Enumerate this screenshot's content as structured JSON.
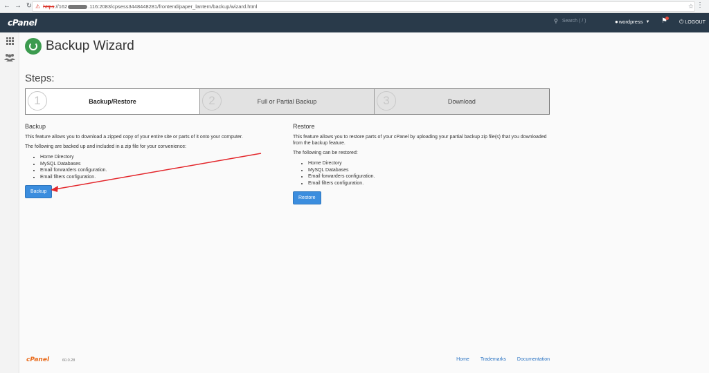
{
  "browser": {
    "url_scheme": "https",
    "url_host_start": "://162",
    "url_rest": ".116:2083/cpsess3448448281/frontend/paper_lantern/backup/wizard.html"
  },
  "header": {
    "logo": "cPanel",
    "search_placeholder": "Search ( / )",
    "username": "wordpress",
    "logout_label": "LOGOUT"
  },
  "page": {
    "title": "Backup Wizard",
    "steps_label": "Steps:"
  },
  "steps": [
    {
      "number": "1",
      "label": "Backup/Restore",
      "active": true
    },
    {
      "number": "2",
      "label": "Full or Partial Backup",
      "active": false
    },
    {
      "number": "3",
      "label": "Download",
      "active": false
    }
  ],
  "backup": {
    "heading": "Backup",
    "description": "This feature allows you to download a zipped copy of your entire site or parts of it onto your computer.",
    "list_intro": "The following are backed up and included in a zip file for your convenience:",
    "items": [
      "Home Directory",
      "MySQL Databases",
      "Email forwarders configuration.",
      "Email filters configuration."
    ],
    "button": "Backup"
  },
  "restore": {
    "heading": "Restore",
    "description": "This feature allows you to restore parts of your cPanel by uploading your partial backup zip file(s) that you downloaded from the backup feature.",
    "list_intro": "The following can be restored:",
    "items": [
      "Home Directory",
      "MySQL Databases",
      "Email forwarders configuration.",
      "Email filters configuration."
    ],
    "button": "Restore"
  },
  "footer": {
    "logo": "cPanel",
    "version": "60.0.28",
    "links": [
      "Home",
      "Trademarks",
      "Documentation"
    ]
  },
  "colors": {
    "header_bg": "#293a4a",
    "button_blue": "#3b8dde",
    "annotation_arrow": "#e3262b",
    "footer_logo": "#e96d1f"
  }
}
